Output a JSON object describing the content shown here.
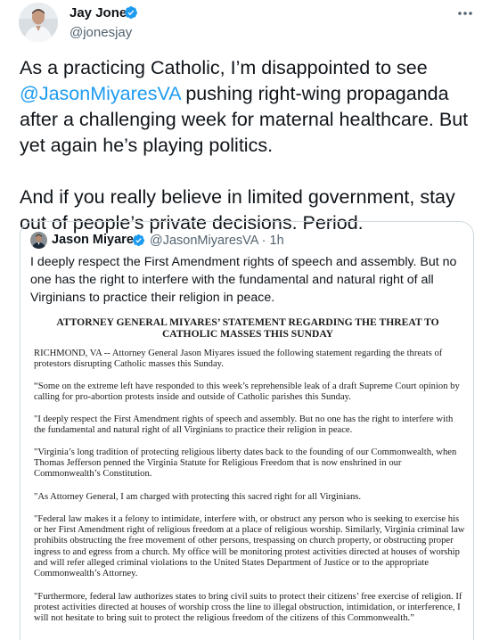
{
  "author": {
    "name": "Jay Jones",
    "handle": "@jonesjay"
  },
  "icons": {
    "more": "more-horizontal-icon",
    "verified": "verified-badge-icon"
  },
  "colors": {
    "link": "#1d9bf0",
    "verified": "#1d9bf0",
    "secondary_text": "#536471",
    "border": "#cfd9de"
  },
  "tweet": {
    "p1_before": "As a practicing Catholic, I’m disappointed to see ",
    "p1_mention": "@JasonMiyaresVA",
    "p1_after": " pushing right-wing propaganda after a challenging week for maternal healthcare. But yet again he’s playing politics.",
    "p2": "And if you really believe in limited government, stay out of people’s private decisions. Period."
  },
  "quoted": {
    "name": "Jason Miyares",
    "handle_time": "@JasonMiyaresVA · 1h",
    "text": "I deeply respect the First Amendment rights of speech and assembly. But no one has the right to interfere with the fundamental and natural right of all Virginians to practice their religion in peace.",
    "document": {
      "title": "ATTORNEY GENERAL MIYARES’ STATEMENT REGARDING THE THREAT TO CATHOLIC MASSES THIS SUNDAY",
      "paragraphs": [
        "RICHMOND, VA -- Attorney General Jason Miyares issued the following statement regarding the threats of protestors disrupting Catholic masses this Sunday.",
        "“Some on the extreme left have responded to this week’s reprehensible leak of a draft Supreme Court opinion by calling for pro-abortion protests inside and outside of Catholic parishes this Sunday.",
        "\"I deeply respect the First Amendment rights of speech and assembly. But no one has the right to interfere with the fundamental and natural right of all Virginians to practice their religion in peace.",
        "\"Virginia’s long tradition of protecting religious liberty dates back to the founding of our Commonwealth, when Thomas Jefferson penned the Virginia Statute for Religious Freedom that is now enshrined in our Commonwealth’s Constitution.",
        "\"As Attorney General, I am charged with protecting this sacred right for all Virginians.",
        "\"Federal law makes it a felony to intimidate, interfere with, or obstruct any person who is seeking to exercise his or her First Amendment right of religious freedom at a place of religious worship. Similarly, Virginia criminal law prohibits obstructing the free movement of other persons, trespassing on church property, or obstructing proper ingress to and egress from a church. My office will be monitoring protest activities directed at houses of worship and will refer alleged criminal violations to the United States Department of Justice or to the appropriate Commonwealth’s Attorney.",
        "\"Furthermore, federal law authorizes states to bring civil suits to protect their citizens’ free exercise of religion. If protest activities directed at houses of worship cross the line to illegal obstruction, intimidation, or interference, I will not hesitate to bring suit to protect the religious freedom of the citizens of this Commonwealth.”"
      ]
    }
  }
}
